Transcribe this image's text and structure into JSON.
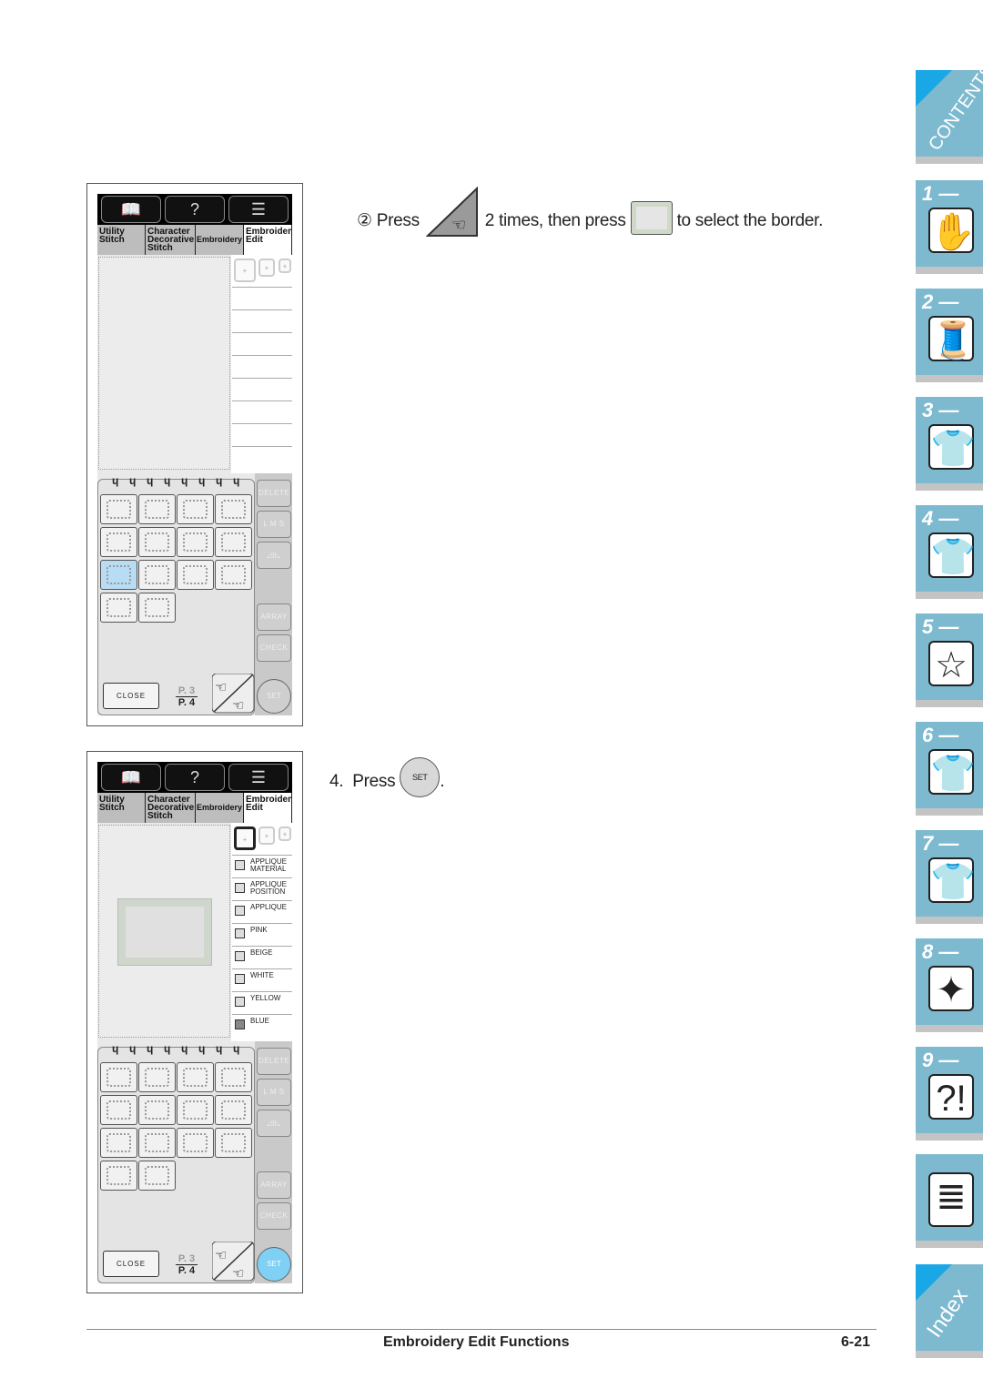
{
  "step2": {
    "marker": "②",
    "press": "Press",
    "mid": "2 times, then press",
    "end": "to select the border."
  },
  "step4": {
    "num": "4.",
    "press": "Press",
    "set": "SET",
    "end": "."
  },
  "screen": {
    "tabs": [
      "Utility Stitch",
      "Character Decorative Stitch",
      "Embroidery",
      "Embroidery Edit"
    ],
    "buttons": {
      "delete": "DELETE",
      "lms": "L M S",
      "array": "ARRAY",
      "check": "CHECK",
      "set": "SET",
      "close": "CLOSE"
    },
    "page_current": "P. 3",
    "page_total": "P. 4"
  },
  "screen2_threads": [
    "APPLIQUE MATERIAL",
    "APPLIQUE POSITION",
    "APPLIQUE",
    "PINK",
    "BEIGE",
    "WHITE",
    "YELLOW",
    "BLUE"
  ],
  "side_tabs": [
    {
      "label": "CONTENTS",
      "icon": "contents"
    },
    {
      "label": "1 —",
      "icon": "sewing-machine-hand-icon"
    },
    {
      "label": "2 —",
      "icon": "thread-spool-icon"
    },
    {
      "label": "3 —",
      "icon": "shirt-icon"
    },
    {
      "label": "4 —",
      "icon": "shirt-abc-icon"
    },
    {
      "label": "5 —",
      "icon": "hoop-icon"
    },
    {
      "label": "6 —",
      "icon": "shirt-embroidery-icon"
    },
    {
      "label": "7 —",
      "icon": "shirt-brush-icon"
    },
    {
      "label": "8 —",
      "icon": "machine-maintenance-icon"
    },
    {
      "label": "9 —",
      "icon": "machine-troubleshoot-icon"
    },
    {
      "label": "",
      "icon": "documents-icon"
    },
    {
      "label": "Index",
      "icon": "index"
    }
  ],
  "colors": {
    "side_tab": "#7db9cf",
    "accent": "#1aa7e6",
    "set_active": "#7fd0f4",
    "selected_thumb": "#b8dcf4"
  },
  "footer": {
    "title": "Embroidery Edit Functions",
    "page": "6-21"
  }
}
